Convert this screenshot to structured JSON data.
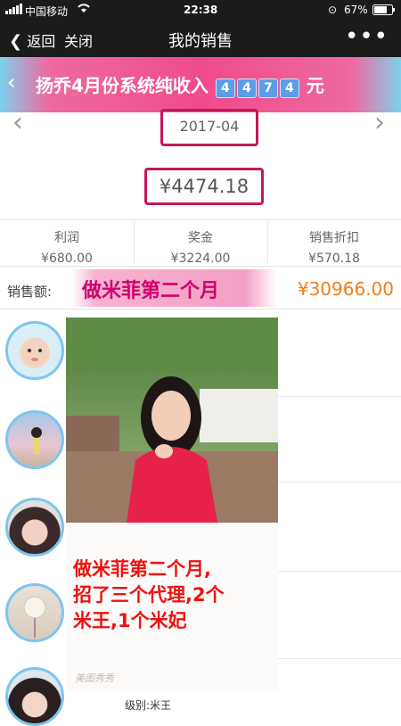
{
  "status_bar": {
    "carrier": "中国移动",
    "time": "22:38",
    "battery": "67%"
  },
  "nav": {
    "back": "返回",
    "close": "关闭",
    "title": "我的销售",
    "more": "•••"
  },
  "banner": {
    "text": "扬乔4月份系统纯收入",
    "digits": [
      "4",
      "4",
      "7",
      "4"
    ],
    "suffix": "元"
  },
  "summary": {
    "month": "2017-04",
    "total": "¥4474.18"
  },
  "stats": [
    {
      "label": "利润",
      "value": "¥680.00"
    },
    {
      "label": "奖金",
      "value": "¥3224.00"
    },
    {
      "label": "销售折扣",
      "value": "¥570.18"
    }
  ],
  "sales": {
    "label": "销售额:",
    "overlay": "做米菲第二个月",
    "value": "¥30966.00"
  },
  "note": {
    "lines": [
      "做米菲第二个月,",
      "招了三个代理,2个",
      "米王,1个米妃"
    ],
    "watermark": "美图秀秀"
  },
  "list_item": {
    "level": "级别:米王"
  },
  "colors": {
    "accent": "#f04b8c",
    "highlight_border": "#c2185b",
    "amount": "#f07d1b",
    "note_text": "#ee1111"
  }
}
